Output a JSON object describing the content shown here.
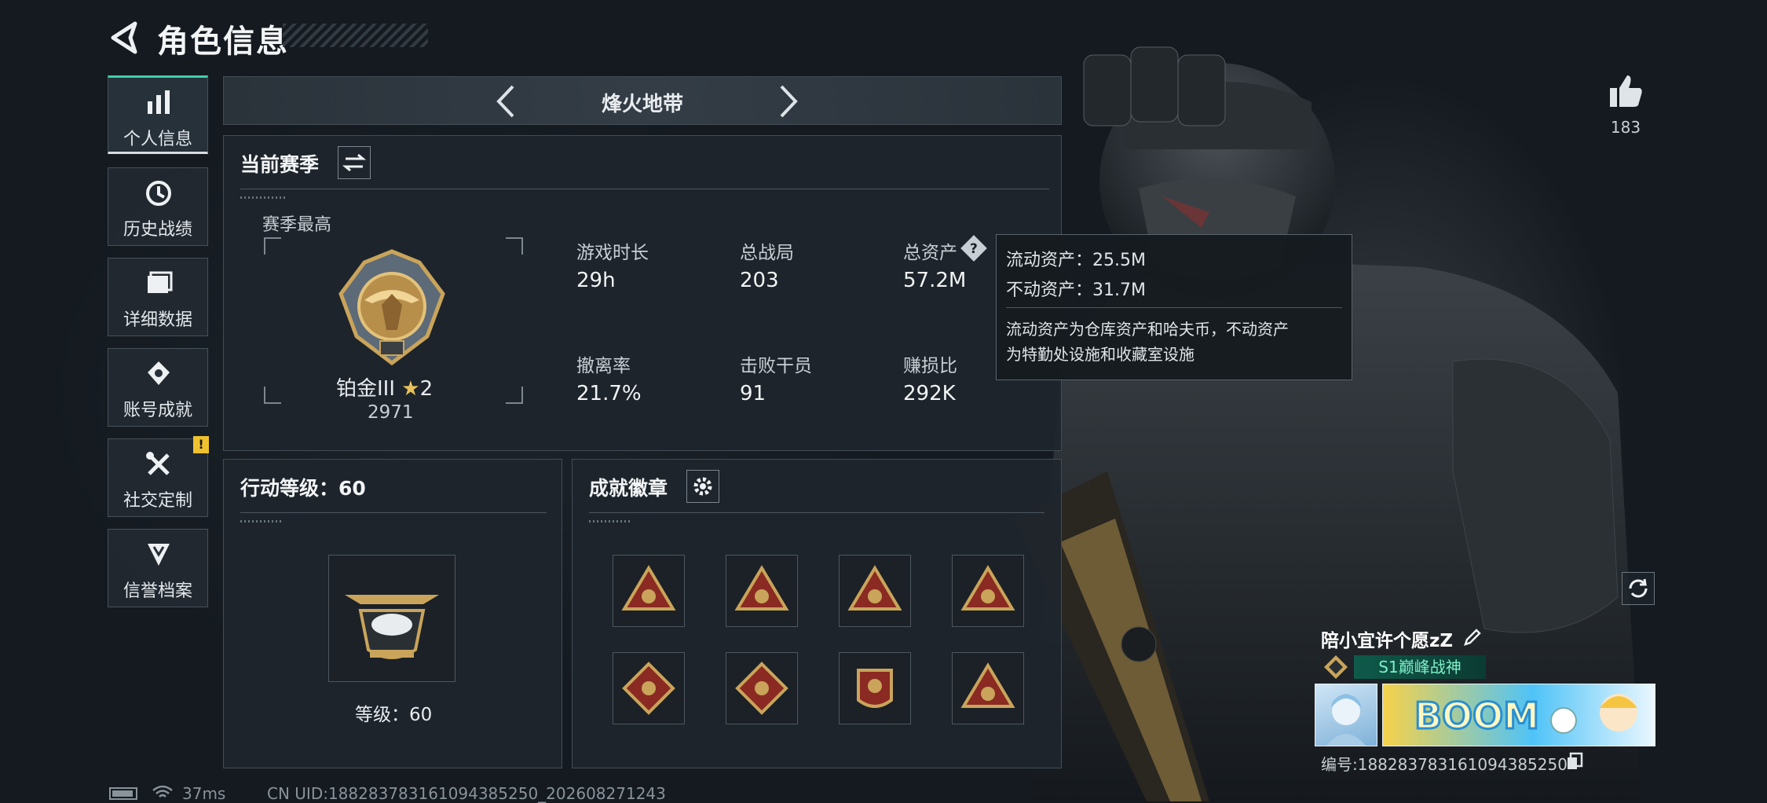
{
  "header": {
    "title": "角色信息"
  },
  "sidebar": {
    "items": [
      {
        "label": "个人信息",
        "icon": "bar-chart-icon",
        "active": true
      },
      {
        "label": "历史战绩",
        "icon": "history-clock-icon"
      },
      {
        "label": "详细数据",
        "icon": "folder-icon"
      },
      {
        "label": "账号成就",
        "icon": "achievement-icon"
      },
      {
        "label": "社交定制",
        "icon": "tools-icon",
        "badge": "!"
      },
      {
        "label": "信誉档案",
        "icon": "shield-rank-icon"
      }
    ]
  },
  "mode": {
    "title": "烽火地带"
  },
  "season": {
    "title": "当前赛季",
    "best_label": "赛季最高",
    "rank_name": "铂金III",
    "rank_stars": "2",
    "rank_score": "2971",
    "stats": [
      {
        "label": "游戏时长",
        "value": "29h"
      },
      {
        "label": "总战局",
        "value": "203"
      },
      {
        "label": "总资产",
        "value": "57.2M"
      },
      {
        "label": "撤离率",
        "value": "21.7%"
      },
      {
        "label": "击败干员",
        "value": "91"
      },
      {
        "label": "赚损比",
        "value": "292K"
      }
    ],
    "help_icon": "?"
  },
  "tooltip": {
    "liquid": "流动资产：25.5M",
    "fixed": "不动资产：31.7M",
    "desc_line1": "流动资产为仓库资产和哈夫币，不动资产",
    "desc_line2": "为特勤处设施和收藏室设施"
  },
  "action_level": {
    "title": "行动等级：60",
    "level_text": "等级：60"
  },
  "badges": {
    "title": "成就徽章",
    "count": 8
  },
  "right": {
    "like_count": "183",
    "player_name": "陪小宜许个愿zZ",
    "title_tag": "S1巅峰战神",
    "player_id": "编号:18828378316109438525​0"
  },
  "status_bar": {
    "ping": "37ms",
    "uid": "CN UID:18828378316109438525​0_202608271243"
  },
  "colors": {
    "accent": "#3fd0a8",
    "gold": "#c9a45a",
    "badge_red": "#8a2a22"
  }
}
